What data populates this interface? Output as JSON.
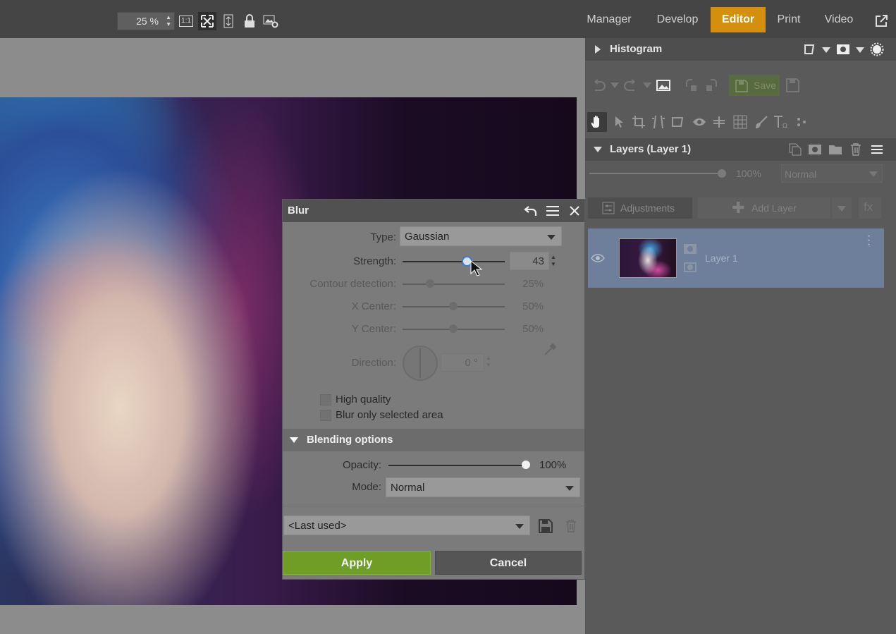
{
  "toolbar": {
    "zoom_value": "25 %",
    "one_to_one_label": "1:1",
    "icons": [
      "one-to-one-icon",
      "fit-screen-icon",
      "fit-height-icon",
      "lock-icon",
      "image-settings-icon"
    ]
  },
  "modules": [
    {
      "label": "Manager",
      "active": false
    },
    {
      "label": "Develop",
      "active": false
    },
    {
      "label": "Editor",
      "active": true
    },
    {
      "label": "Print",
      "active": false
    },
    {
      "label": "Video",
      "active": false
    }
  ],
  "right_panel": {
    "histogram_title": "Histogram",
    "save_label": "Save",
    "layers_title": "Layers (Layer 1)",
    "layer_opacity": "100%",
    "layer_mode": "Normal",
    "adjustments_label": "Adjustments",
    "add_layer_label": "Add Layer",
    "fx_label": "fx",
    "layer_name": "Layer 1"
  },
  "blur_dialog": {
    "title": "Blur",
    "type_label": "Type:",
    "type_value": "Gaussian",
    "strength_label": "Strength:",
    "strength_value": "43",
    "strength_level": 0.63,
    "contour_label": "Contour detection:",
    "contour_value": "25%",
    "contour_level": 0.25,
    "xcenter_label": "X Center:",
    "xcenter_value": "50%",
    "ycenter_label": "Y Center:",
    "ycenter_value": "50%",
    "direction_label": "Direction:",
    "direction_value": "0 °",
    "high_quality_label": "High quality",
    "high_quality_checked": false,
    "blur_selected_label": "Blur only selected area",
    "blur_selected_checked": false,
    "blending_title": "Blending options",
    "opacity_label": "Opacity:",
    "opacity_value": "100%",
    "mode_label": "Mode:",
    "mode_value": "Normal",
    "preset_value": "<Last used>",
    "apply_label": "Apply",
    "cancel_label": "Cancel"
  },
  "colors": {
    "accent": "#d4900d",
    "apply_button": "#6e9e25",
    "topbar": "#454545",
    "layer_selected": "#6d7f9a"
  }
}
